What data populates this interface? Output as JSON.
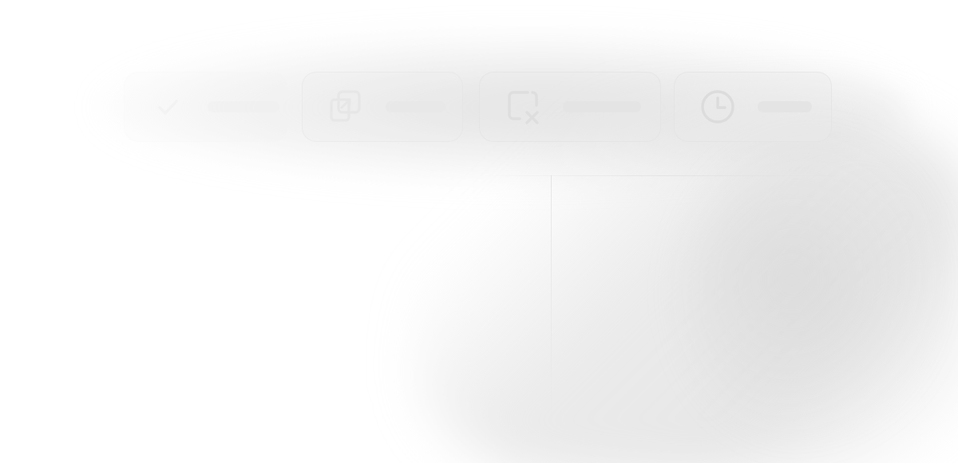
{
  "toolbar": {
    "items": [
      {
        "icon": "check-icon",
        "label": ""
      },
      {
        "icon": "copy-icon",
        "label": ""
      },
      {
        "icon": "clear-selection-icon",
        "label": ""
      },
      {
        "icon": "clock-icon",
        "label": ""
      }
    ]
  },
  "colors": {
    "icon": "#e2e2e2",
    "bar": "#e4e4e4",
    "background": "#ffffff"
  }
}
